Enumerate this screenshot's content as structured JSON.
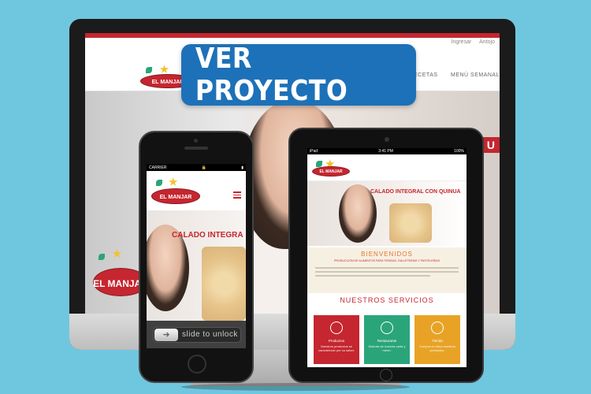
{
  "cta": {
    "label": "VER PROYECTO",
    "color": "#1d71b8"
  },
  "brand": {
    "name": "EL MANJAR",
    "accent": "#c5262f",
    "secondary": "#2aa57a",
    "orange": "#e8742c"
  },
  "desktop": {
    "top_links": [
      "Ingresar",
      "Antojo"
    ],
    "nav": [
      "RECETAS",
      "MENÚ SEMANAL"
    ],
    "hero_tag": "U"
  },
  "tablet": {
    "status": {
      "carrier": "iPad",
      "time": "3:41 PM",
      "battery": "100%"
    },
    "hero_title": "CALADO INTEGRAL CON QUINUA",
    "welcome": {
      "title": "BIENVENIDOS",
      "subtitle": "PRODUCCIÓN DE ALIMENTOS PARA TIENDAS, GALLETERÍAS Y PASTELERÍAS"
    },
    "services_title": "NUESTROS SERVICIOS",
    "services": [
      {
        "title": "Productos",
        "desc": "Nuestros productos se caracterizan por su sabor.",
        "icon": "basket-icon"
      },
      {
        "title": "Restaurante",
        "desc": "Disfruta de nuestra carta y menú.",
        "icon": "cutlery-icon"
      },
      {
        "title": "Tienda",
        "desc": "Compra en línea nuestros productos.",
        "icon": "shopping-bag-icon"
      }
    ]
  },
  "phone": {
    "status": {
      "carrier": "CARRIER",
      "time": ""
    },
    "hero_title": "CALADO INTEGRA",
    "unlock": {
      "label": "slide to unlock",
      "knob": "➜"
    }
  }
}
